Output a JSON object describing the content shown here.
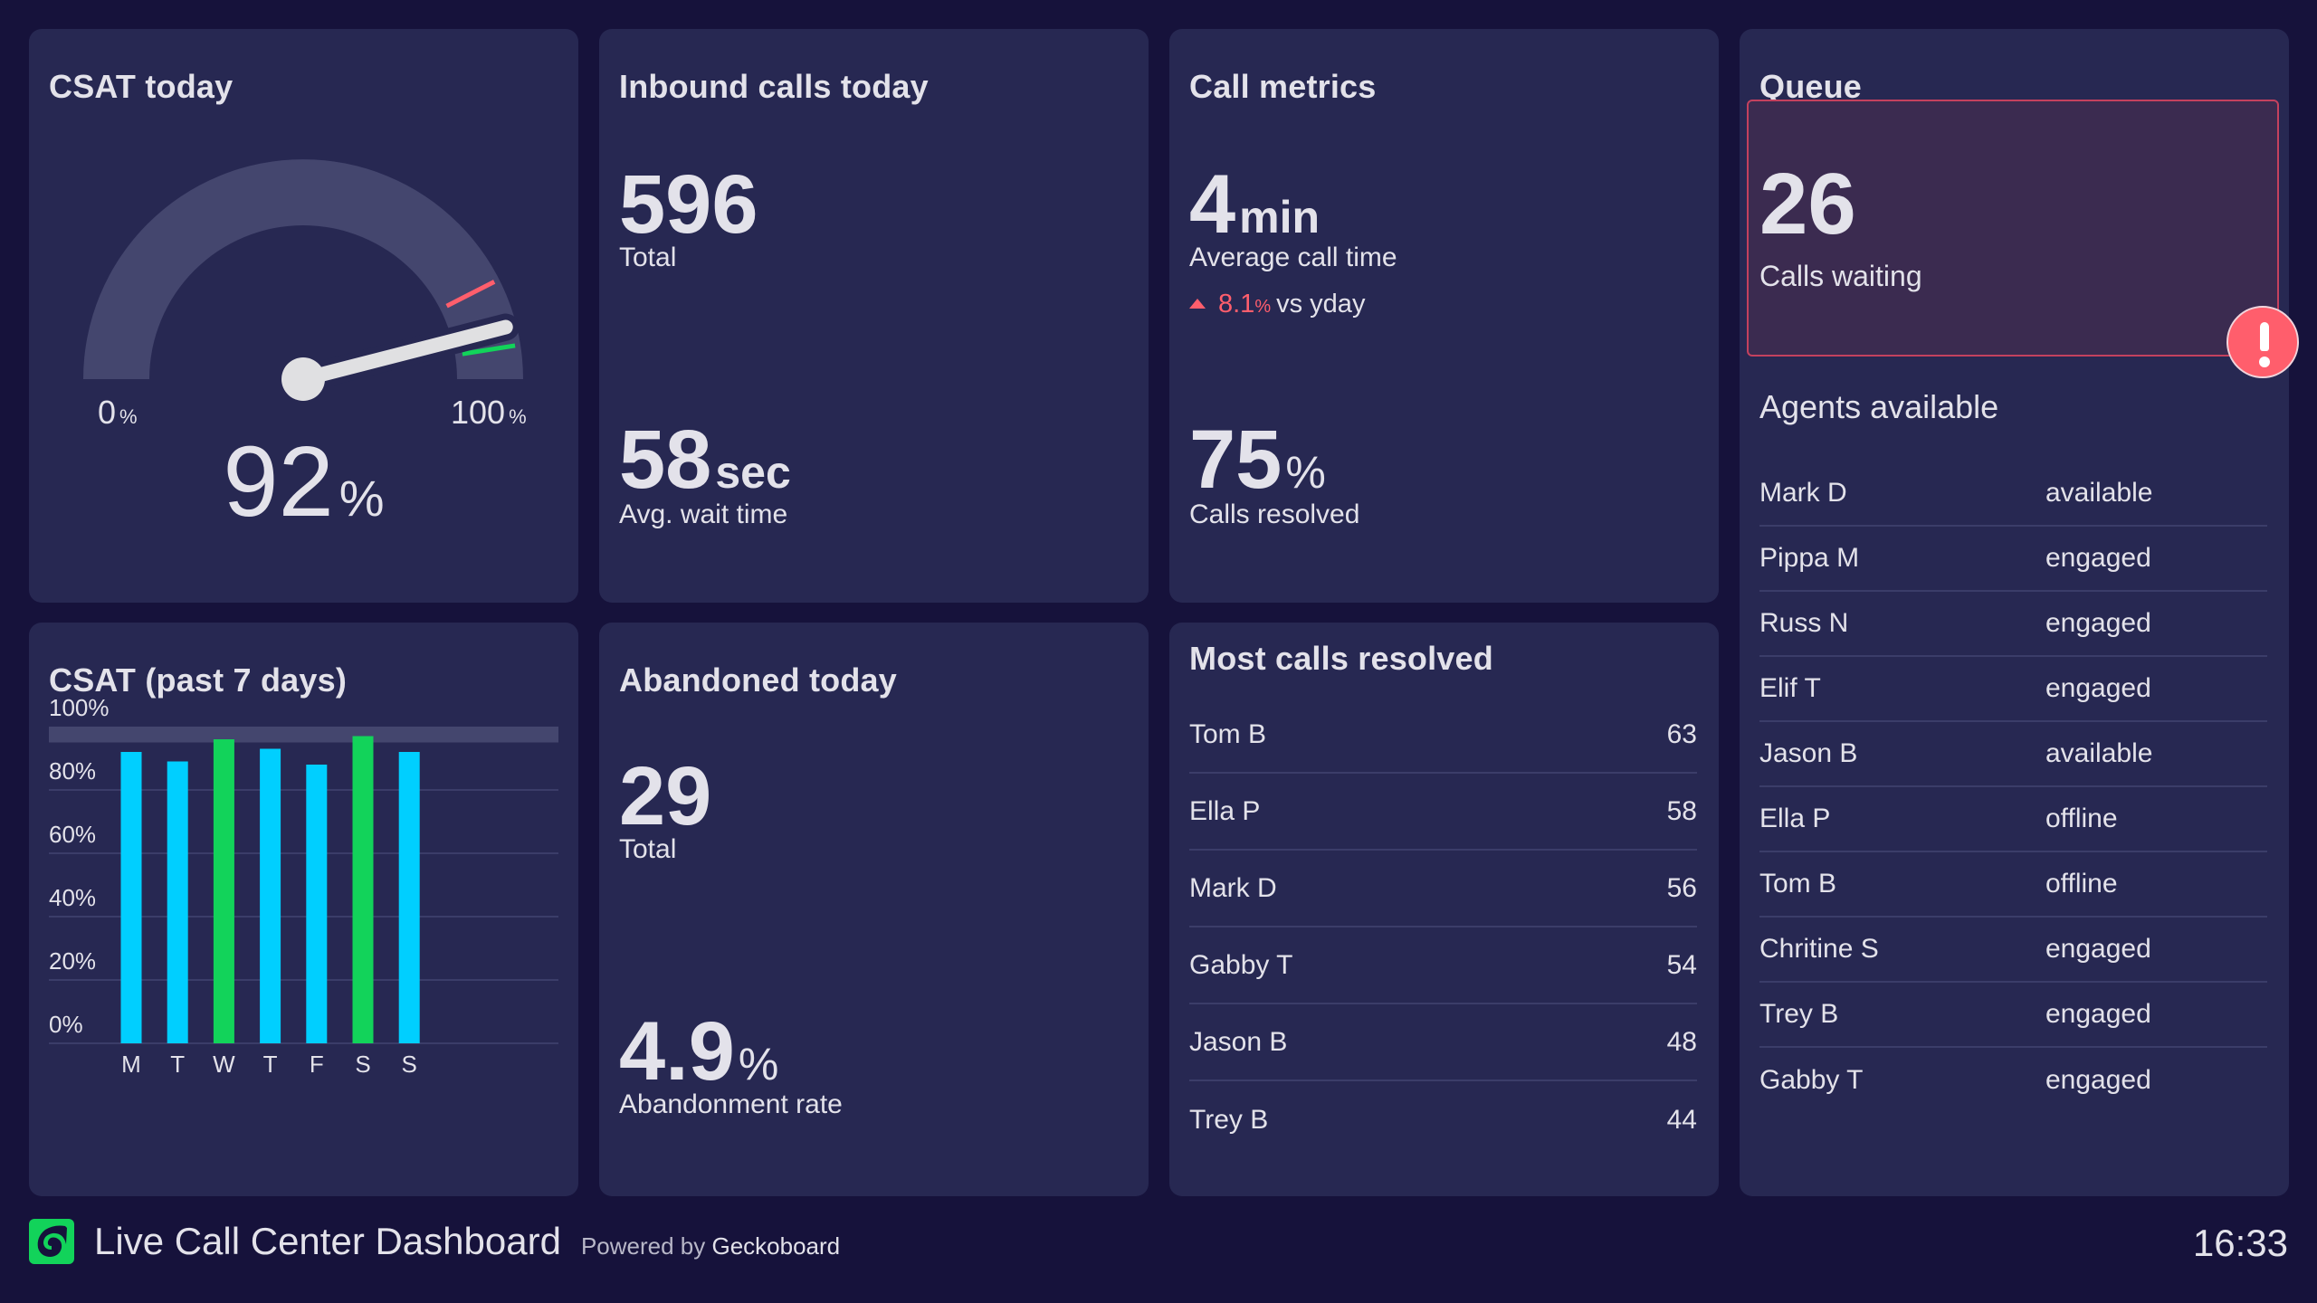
{
  "colors": {
    "background": "#16123b",
    "card": "#272852",
    "text": "#e3e2ea",
    "bar_default": "#00cfff",
    "bar_goal_met": "#12d35a",
    "alert": "#ff5e6c",
    "track": "#44466e"
  },
  "csat_today": {
    "title": "CSAT today",
    "value": "92",
    "unit": "%",
    "value_percent": 92,
    "min_label": "0",
    "max_label": "100",
    "min_unit": "%",
    "max_unit": "%",
    "red_threshold_percent": 85,
    "green_threshold_percent": 95
  },
  "inbound_calls": {
    "title": "Inbound calls today",
    "total_value": "596",
    "total_label": "Total",
    "wait_value": "58",
    "wait_unit": "sec",
    "wait_label": "Avg. wait time"
  },
  "call_metrics": {
    "title": "Call metrics",
    "avg_value": "4",
    "avg_unit": "min",
    "avg_label": "Average call time",
    "trend_direction": "up",
    "trend_value": "8.1",
    "trend_unit": "%",
    "trend_text": "vs yday",
    "resolved_value": "75",
    "resolved_unit": "%",
    "resolved_label": "Calls resolved"
  },
  "queue": {
    "title": "Queue",
    "calls_waiting_value": "26",
    "calls_waiting_label": "Calls waiting",
    "alert_icon": "exclamation-icon",
    "agents_title": "Agents available",
    "agents": [
      {
        "name": "Mark D",
        "status": "available"
      },
      {
        "name": "Pippa M",
        "status": "engaged"
      },
      {
        "name": "Russ N",
        "status": "engaged"
      },
      {
        "name": "Elif T",
        "status": "engaged"
      },
      {
        "name": "Jason B",
        "status": "available"
      },
      {
        "name": "Ella P",
        "status": "offline"
      },
      {
        "name": "Tom B",
        "status": "offline"
      },
      {
        "name": "Chritine S",
        "status": "engaged"
      },
      {
        "name": "Trey B",
        "status": "engaged"
      },
      {
        "name": "Gabby T",
        "status": "engaged"
      }
    ]
  },
  "abandoned": {
    "title": "Abandoned today",
    "total_value": "29",
    "total_label": "Total",
    "rate_value": "4.9",
    "rate_unit": "%",
    "rate_label": "Abandonment rate"
  },
  "most_resolved": {
    "title": "Most calls resolved",
    "rows": [
      {
        "name": "Tom B",
        "value": "63"
      },
      {
        "name": "Ella P",
        "value": "58"
      },
      {
        "name": "Mark D",
        "value": "56"
      },
      {
        "name": "Gabby T",
        "value": "54"
      },
      {
        "name": "Jason B",
        "value": "48"
      },
      {
        "name": "Trey B",
        "value": "44"
      }
    ]
  },
  "chart_data": {
    "type": "bar",
    "title": "CSAT (past 7 days)",
    "categories": [
      "M",
      "T",
      "W",
      "T",
      "F",
      "S",
      "S"
    ],
    "values": [
      92,
      89,
      96,
      93,
      88,
      97,
      92
    ],
    "goal_band": [
      95,
      100
    ],
    "ylim": [
      0,
      100
    ],
    "yticks": [
      0,
      20,
      40,
      60,
      80,
      100
    ],
    "ytick_labels": [
      "0%",
      "20%",
      "40%",
      "60%",
      "80%",
      "100%"
    ],
    "xlabel": "",
    "ylabel": "",
    "grid": true,
    "legend": "none"
  },
  "footer": {
    "title": "Live Call Center Dashboard",
    "powered_prefix": "Powered by",
    "powered_brand": "Geckoboard",
    "clock": "16:33"
  }
}
